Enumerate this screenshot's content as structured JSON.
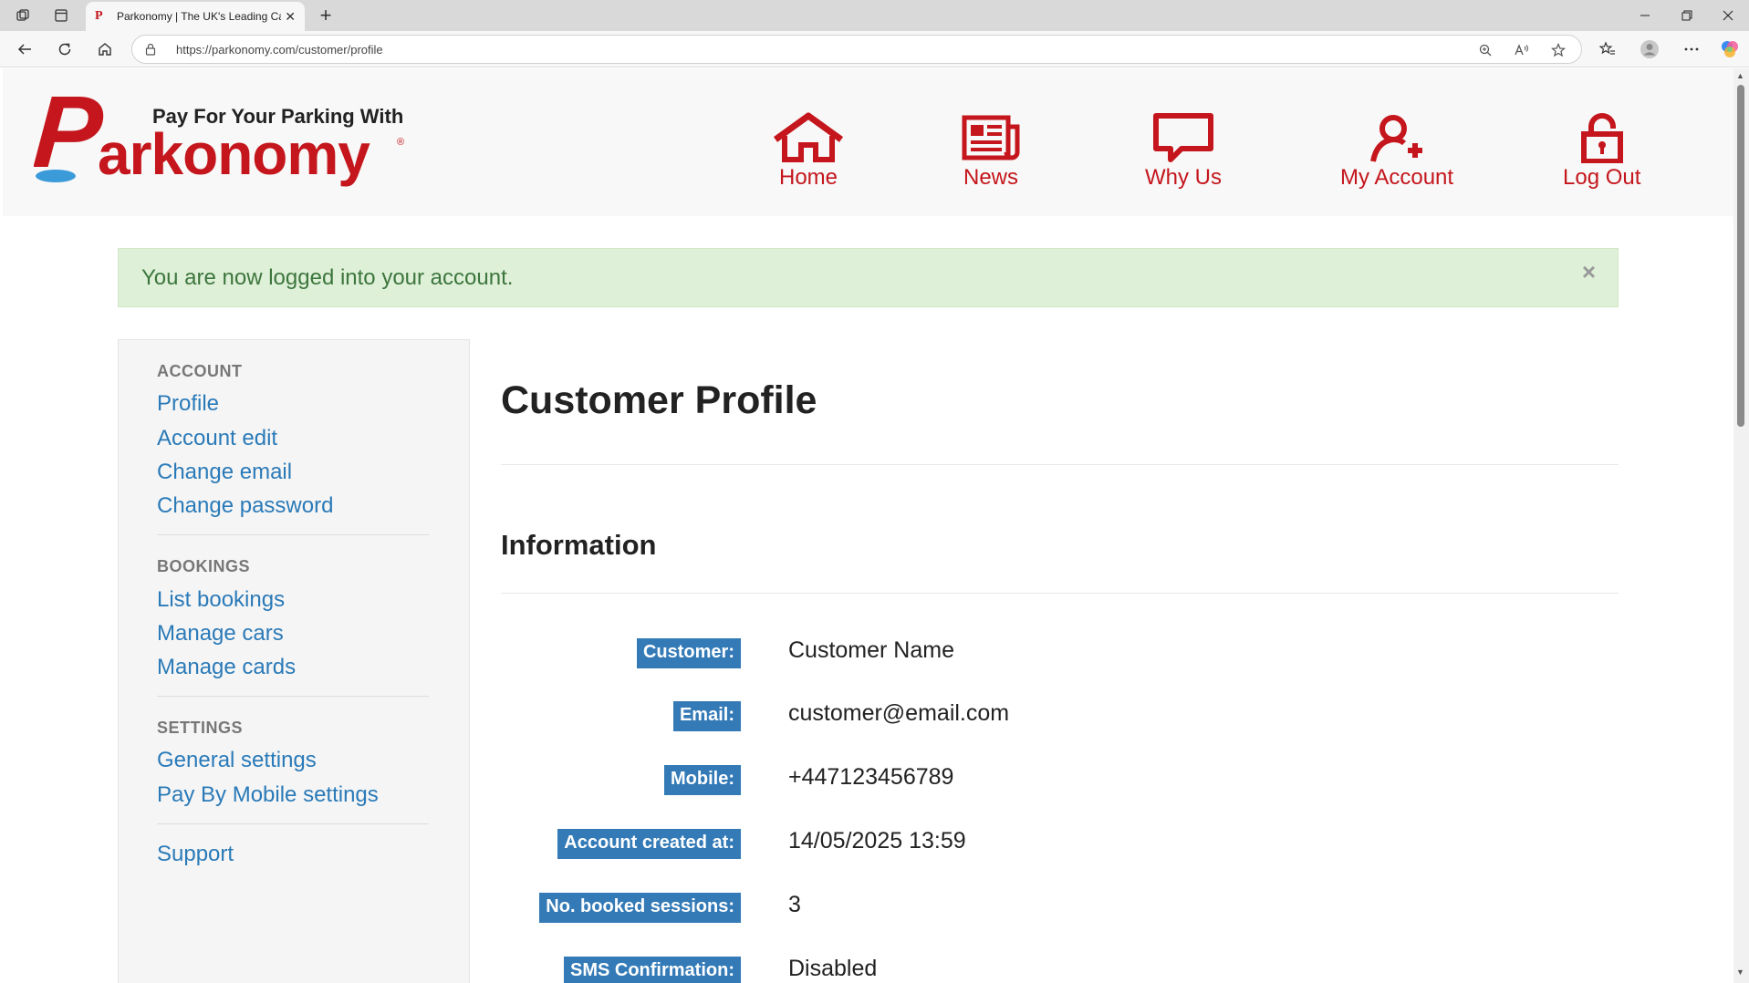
{
  "browser": {
    "tab_title": "Parkonomy | The UK's Leading Car Parking App",
    "tab_favicon": "P",
    "url": "https://parkonomy.com/customer/profile",
    "new_tab_glyph": "+",
    "tab_close_glyph": "✕"
  },
  "header": {
    "logo_tagline": "Pay For Your Parking With",
    "logo_wordmark": "Parkonomy",
    "brand_color": "#c4161c",
    "nav": [
      {
        "label": "Home",
        "icon": "home-icon"
      },
      {
        "label": "News",
        "icon": "newspaper-icon"
      },
      {
        "label": "Why Us",
        "icon": "chat-bubble-icon"
      },
      {
        "label": "My Account",
        "icon": "add-user-icon"
      },
      {
        "label": "Log Out",
        "icon": "unlock-icon"
      }
    ]
  },
  "alert": {
    "message": "You are now logged into your account.",
    "close_glyph": "×"
  },
  "sidebar": {
    "sections": [
      {
        "heading": "ACCOUNT",
        "items": [
          "Profile",
          "Account edit",
          "Change email",
          "Change password"
        ]
      },
      {
        "heading": "BOOKINGS",
        "items": [
          "List bookings",
          "Manage cars",
          "Manage cards"
        ]
      },
      {
        "heading": "SETTINGS",
        "items": [
          "General settings",
          "Pay By Mobile settings"
        ]
      },
      {
        "heading": "",
        "items": [
          "Support"
        ]
      }
    ]
  },
  "content": {
    "title": "Customer Profile",
    "section_title": "Information",
    "fields": [
      {
        "label": "Customer:",
        "value": "Customer Name"
      },
      {
        "label": "Email:",
        "value": "customer@email.com"
      },
      {
        "label": "Mobile:",
        "value": "+447123456789"
      },
      {
        "label": "Account created at:",
        "value": "14/05/2025 13:59"
      },
      {
        "label": "No. booked sessions:",
        "value": "3"
      },
      {
        "label": "SMS Confirmation:",
        "value": "Disabled"
      }
    ],
    "label_color": "#337ab7"
  }
}
